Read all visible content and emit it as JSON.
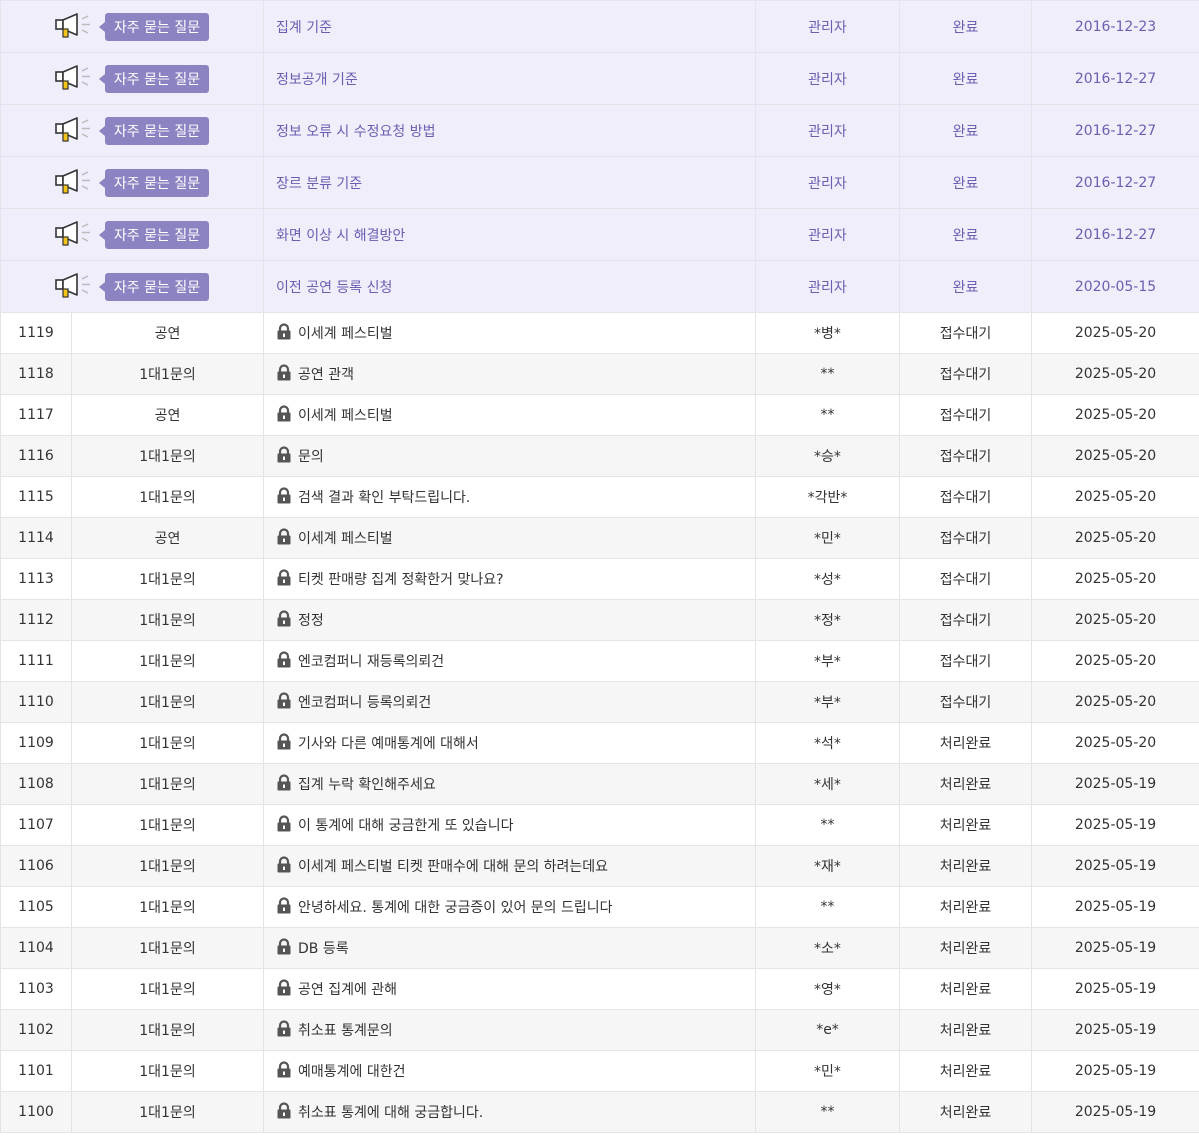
{
  "notice_badge": "자주 묻는 질문",
  "notices": [
    {
      "title": "집계 기준",
      "author": "관리자",
      "status": "완료",
      "date": "2016-12-23"
    },
    {
      "title": "정보공개 기준",
      "author": "관리자",
      "status": "완료",
      "date": "2016-12-27"
    },
    {
      "title": "정보 오류 시 수정요청 방법",
      "author": "관리자",
      "status": "완료",
      "date": "2016-12-27"
    },
    {
      "title": "장르 분류 기준",
      "author": "관리자",
      "status": "완료",
      "date": "2016-12-27"
    },
    {
      "title": "화면 이상 시 해결방안",
      "author": "관리자",
      "status": "완료",
      "date": "2016-12-27"
    },
    {
      "title": "이전 공연 등록 신청",
      "author": "관리자",
      "status": "완료",
      "date": "2020-05-15"
    }
  ],
  "posts": [
    {
      "num": "1119",
      "category": "공연",
      "title": "이세계 페스티벌",
      "author": "*병*",
      "status": "접수대기",
      "date": "2025-05-20"
    },
    {
      "num": "1118",
      "category": "1대1문의",
      "title": "공연 관객",
      "author": "**",
      "status": "접수대기",
      "date": "2025-05-20"
    },
    {
      "num": "1117",
      "category": "공연",
      "title": "이세계 페스티벌",
      "author": "**",
      "status": "접수대기",
      "date": "2025-05-20"
    },
    {
      "num": "1116",
      "category": "1대1문의",
      "title": "문의",
      "author": "*승*",
      "status": "접수대기",
      "date": "2025-05-20"
    },
    {
      "num": "1115",
      "category": "1대1문의",
      "title": "검색 결과 확인 부탁드립니다.",
      "author": "*각반*",
      "status": "접수대기",
      "date": "2025-05-20"
    },
    {
      "num": "1114",
      "category": "공연",
      "title": "이세계 페스티벌",
      "author": "*민*",
      "status": "접수대기",
      "date": "2025-05-20"
    },
    {
      "num": "1113",
      "category": "1대1문의",
      "title": "티켓 판매량 집계 정확한거 맞나요?",
      "author": "*성*",
      "status": "접수대기",
      "date": "2025-05-20"
    },
    {
      "num": "1112",
      "category": "1대1문의",
      "title": "정정",
      "author": "*정*",
      "status": "접수대기",
      "date": "2025-05-20"
    },
    {
      "num": "1111",
      "category": "1대1문의",
      "title": "엔코컴퍼니 재등록의뢰건",
      "author": "*부*",
      "status": "접수대기",
      "date": "2025-05-20"
    },
    {
      "num": "1110",
      "category": "1대1문의",
      "title": "엔코컴퍼니 등록의뢰건",
      "author": "*부*",
      "status": "접수대기",
      "date": "2025-05-20"
    },
    {
      "num": "1109",
      "category": "1대1문의",
      "title": "기사와 다른 예매통계에 대해서",
      "author": "*석*",
      "status": "처리완료",
      "date": "2025-05-20"
    },
    {
      "num": "1108",
      "category": "1대1문의",
      "title": "집계 누락 확인해주세요",
      "author": "*세*",
      "status": "처리완료",
      "date": "2025-05-19"
    },
    {
      "num": "1107",
      "category": "1대1문의",
      "title": "이 통계에 대해 궁금한게 또 있습니다",
      "author": "**",
      "status": "처리완료",
      "date": "2025-05-19"
    },
    {
      "num": "1106",
      "category": "1대1문의",
      "title": "이세계 페스티벌 티켓 판매수에 대해 문의 하려는데요",
      "author": "*재*",
      "status": "처리완료",
      "date": "2025-05-19"
    },
    {
      "num": "1105",
      "category": "1대1문의",
      "title": "안녕하세요. 통계에 대한 궁금증이 있어 문의 드립니다",
      "author": "**",
      "status": "처리완료",
      "date": "2025-05-19"
    },
    {
      "num": "1104",
      "category": "1대1문의",
      "title": "DB 등록",
      "author": "*소*",
      "status": "처리완료",
      "date": "2025-05-19"
    },
    {
      "num": "1103",
      "category": "1대1문의",
      "title": "공연 집계에 관해",
      "author": "*영*",
      "status": "처리완료",
      "date": "2025-05-19"
    },
    {
      "num": "1102",
      "category": "1대1문의",
      "title": "취소표 통계문의",
      "author": "*e*",
      "status": "처리완료",
      "date": "2025-05-19"
    },
    {
      "num": "1101",
      "category": "1대1문의",
      "title": "예매통계에 대한건",
      "author": "*민*",
      "status": "처리완료",
      "date": "2025-05-19"
    },
    {
      "num": "1100",
      "category": "1대1문의",
      "title": "취소표 통계에 대해 궁금합니다.",
      "author": "**",
      "status": "처리완료",
      "date": "2025-05-19"
    }
  ]
}
